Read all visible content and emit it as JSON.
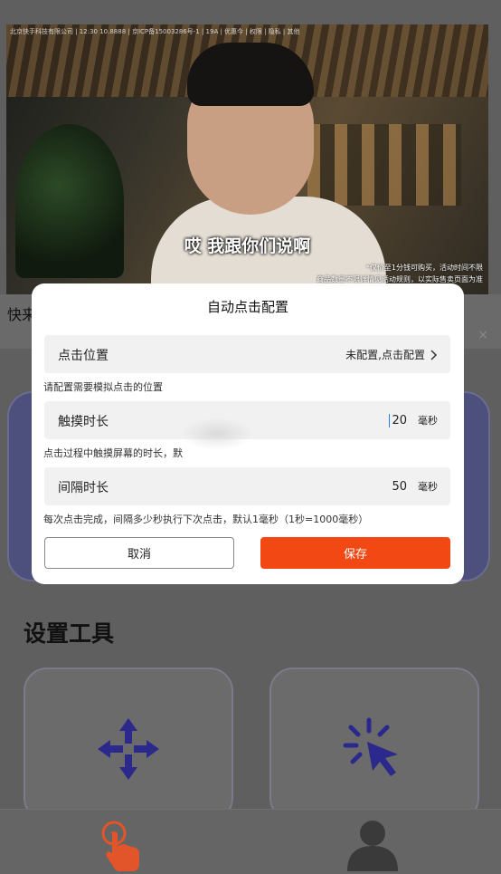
{
  "video": {
    "watermark": "北京快手科技有限公司 | 12:30 10.8888 | 京ICP备15003286号-1 | 19A | 优惠今 | 权限 | 隐私 | 其他",
    "subtitle": "哎 我跟你们说啊",
    "note_line1": "*仅价至1分钱可购买，活动时间不限",
    "note_line2": "商品数量不限详情见活动规则，以实际售卖页面为准"
  },
  "page": {
    "title_fragment": "快来",
    "close_symbol": "×",
    "section_title": "设置工具"
  },
  "dialog": {
    "title": "自动点击配置",
    "position": {
      "label": "点击位置",
      "status": "未配置,点击配置",
      "hint": "请配置需要模拟点击的位置"
    },
    "touch": {
      "label": "触摸时长",
      "value": "20",
      "unit": "毫秒",
      "hint": "点击过程中触摸屏幕的时长，默"
    },
    "interval": {
      "label": "间隔时长",
      "value": "50",
      "unit": "毫秒",
      "hint": "每次点击完成，间隔多少秒执行下次点击，默认1毫秒（1秒=1000毫秒）"
    },
    "cancel_label": "取消",
    "save_label": "保存"
  },
  "colors": {
    "accent": "#f24813",
    "tool_icon": "#2b2a8c",
    "tab_active": "#e2552a"
  },
  "icons": {
    "chevron": "chevron-right-icon",
    "tool_left": "move-arrows-icon",
    "tool_right": "click-cursor-icon",
    "tab_left": "tap-hand-icon",
    "tab_right": "user-icon"
  }
}
